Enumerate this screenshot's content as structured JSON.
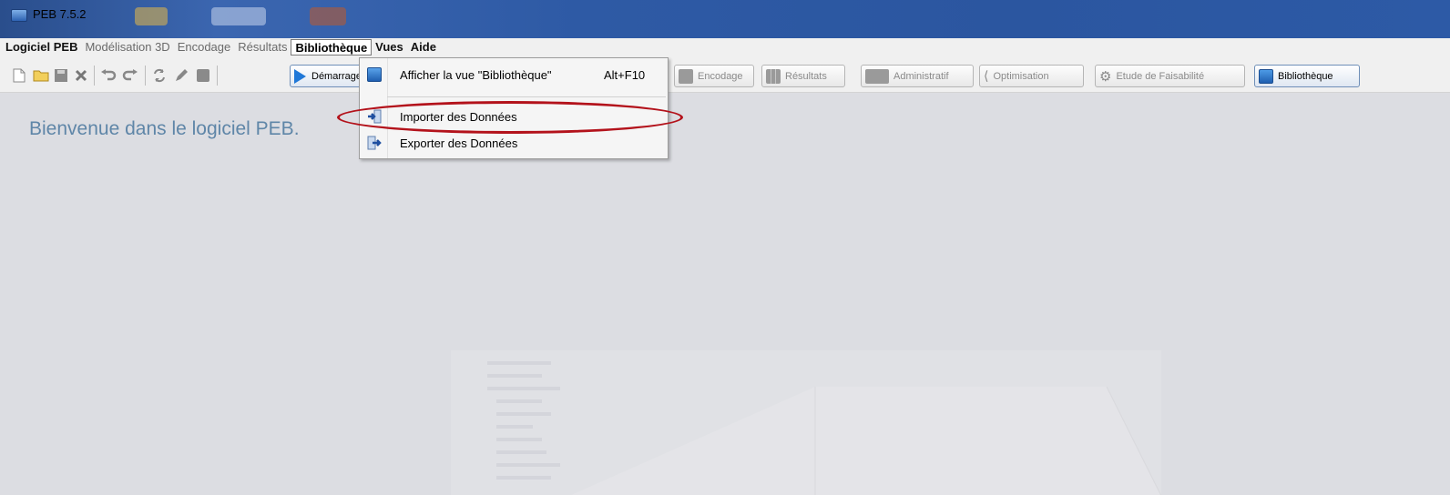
{
  "window": {
    "title": "PEB 7.5.2",
    "accent_color": "#2b56a0"
  },
  "menubar": {
    "items": [
      {
        "label": "Logiciel PEB",
        "state": "bold"
      },
      {
        "label": "Modélisation 3D",
        "state": "dim"
      },
      {
        "label": "Encodage",
        "state": "dim"
      },
      {
        "label": "Résultats",
        "state": "dim"
      },
      {
        "label": "Bibliothèque",
        "state": "active"
      },
      {
        "label": "Vues",
        "state": "bold"
      },
      {
        "label": "Aide",
        "state": "bold"
      }
    ]
  },
  "toolbar": {
    "icons": [
      "new-file-icon",
      "open-folder-icon",
      "save-icon",
      "close-icon",
      "undo-icon",
      "redo-icon",
      "refresh-icon",
      "edit-icon",
      "stop-icon"
    ],
    "buttons": [
      {
        "label": "Démarrage",
        "icon": "play-icon",
        "enabled": true
      },
      {
        "label": "Encodage",
        "icon": "encodage-icon",
        "enabled": false
      },
      {
        "label": "Résultats",
        "icon": "results-icon",
        "enabled": false
      },
      {
        "label": "Administratif",
        "icon": "admin-icon",
        "enabled": false
      },
      {
        "label": "Optimisation",
        "icon": "optimisation-icon",
        "enabled": false
      },
      {
        "label": "Etude de Faisabilité",
        "icon": "gear-icon",
        "enabled": false
      },
      {
        "label": "Bibliothèque",
        "icon": "library-icon",
        "enabled": true
      }
    ]
  },
  "dropdown": {
    "items": [
      {
        "label": "Afficher la vue \"Bibliothèque\"",
        "shortcut": "Alt+F10",
        "icon": "library-view-icon"
      },
      {
        "label": "Importer des Données",
        "shortcut": "",
        "icon": "import-icon"
      },
      {
        "label": "Exporter des Données",
        "shortcut": "",
        "icon": "export-icon"
      }
    ],
    "highlighted_item": "Importer des Données",
    "highlight_color": "#b3121b"
  },
  "content": {
    "welcome": "Bienvenue dans le logiciel PEB."
  }
}
